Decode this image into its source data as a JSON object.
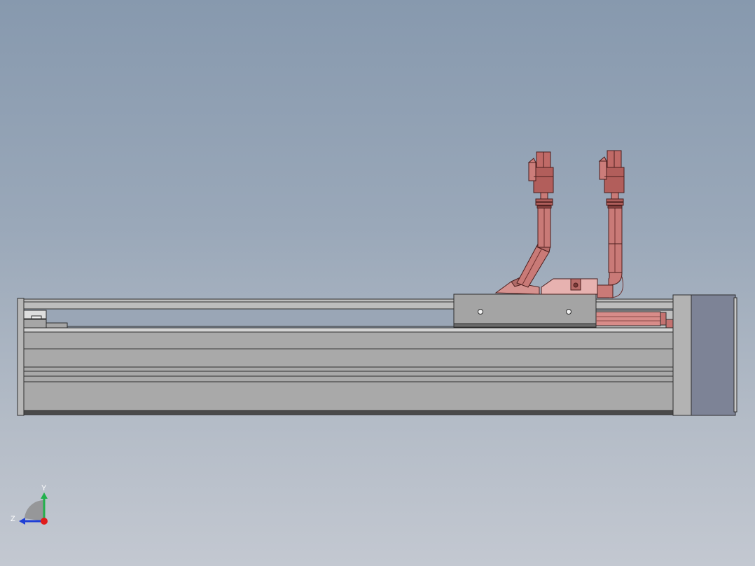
{
  "view": {
    "background_top": "#8799ae",
    "background_bottom": "#c3c8d1"
  },
  "triad": {
    "y_label": "Y",
    "z_label": "Z",
    "y_color": "#22b14c",
    "z_color": "#1f3fd6",
    "x_color": "#e01b1b"
  },
  "colors": {
    "rail_body": "#a8a8a8",
    "rail_light": "#c9c9c9",
    "rail_edge": "#3a3a3a",
    "carriage": "#a3a3a3",
    "motor_flange": "#b0b0b0",
    "motor": "#7b8294",
    "hose": "#c77876",
    "hose_dark": "#7a3a38",
    "fitting": "#d9a3a1"
  }
}
